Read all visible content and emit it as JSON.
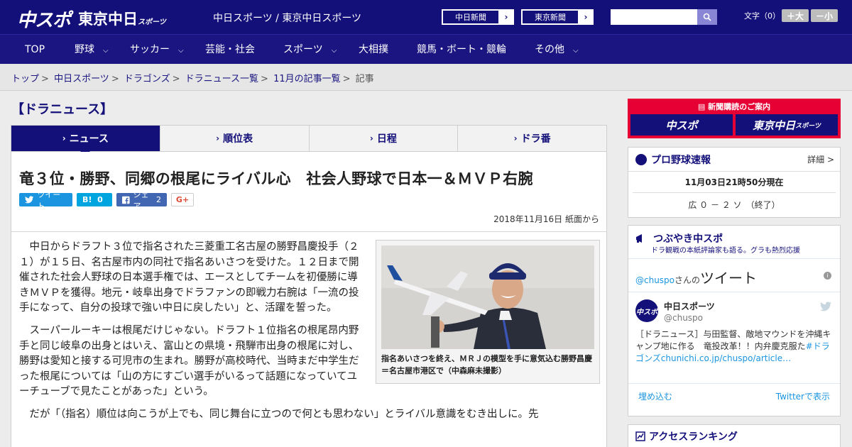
{
  "header": {
    "logo_chuspo": "中スポ",
    "logo_tokyo": "東京中日",
    "logo_tokyo_sub": "スポーツ",
    "site_title": "中日スポーツ / 東京中日スポーツ",
    "ext_links": [
      {
        "label": "中日新聞",
        "arrow": "›"
      },
      {
        "label": "東京新聞",
        "arrow": "›"
      }
    ],
    "search_placeholder": "",
    "font_size_label": "文字（0）",
    "font_larger": "＋大",
    "font_smaller": "－小"
  },
  "nav": {
    "items": [
      {
        "label": "TOP",
        "chevron": ""
      },
      {
        "label": "野球",
        "chevron": "⌵"
      },
      {
        "label": "サッカー",
        "chevron": "⌵"
      },
      {
        "label": "芸能・社会",
        "chevron": ""
      },
      {
        "label": "スポーツ",
        "chevron": "⌵"
      },
      {
        "label": "大相撲",
        "chevron": ""
      },
      {
        "label": "競馬・ボート・競輪",
        "chevron": ""
      },
      {
        "label": "その他",
        "chevron": "⌵"
      }
    ]
  },
  "breadcrumb": {
    "items": [
      "トップ",
      "中日スポーツ",
      "ドラゴンズ",
      "ドラニュース一覧",
      "11月の記事一覧"
    ],
    "current": "記事",
    "sep": ">"
  },
  "section": {
    "heading": "【ドラニュース】"
  },
  "tabs": [
    {
      "label": "ニュース",
      "active": true
    },
    {
      "label": "順位表",
      "active": false
    },
    {
      "label": "日程",
      "active": false
    },
    {
      "label": "ドラ番",
      "active": false
    }
  ],
  "article": {
    "title": "竜３位・勝野、同郷の根尾にライバル心　社会人野球で日本一＆ＭＶＰ右腕",
    "share": {
      "tweet": "ツイート",
      "hatena_icon": "B!",
      "hatena_count": "0",
      "facebook": "シェア",
      "facebook_count": "2",
      "gplus": "G+"
    },
    "date": "2018年11月16日 紙面から",
    "photo_caption": "指名あいさつを終え、ＭＲＪの模型を手に意気込む勝野昌慶＝名古屋市港区で（中森麻未撮影）",
    "paragraphs": [
      "中日からドラフト３位で指名された三菱重工名古屋の勝野昌慶投手（２１）が１５日、名古屋市内の同社で指名あいさつを受けた。１２日まで開催された社会人野球の日本選手権では、エースとしてチームを初優勝に導きＭＶＰを獲得。地元・岐阜出身でドラファンの即戦力右腕は「一流の投手になって、自分の投球で強い中日に戻したい」と、活躍を誓った。",
      "スーパールーキーは根尾だけじゃない。ドラフト１位指名の根尾昂内野手と同じ岐阜の出身とはいえ、富山との県境・飛騨市出身の根尾に対し、勝野は愛知と接する可児市の生まれ。勝野が高校時代、当時まだ中学生だった根尾については「山の方にすごい選手がいるって話題になっていてユーチューブで見たことがあった」という。",
      "だが「（指名）順位は向こうが上でも、同じ舞台に立つので何とも思わない」とライバル意識をむき出しに。先"
    ]
  },
  "sidebar": {
    "subscribe": {
      "title": "新聞購読のご案内",
      "btn_chuspo": "中スポ",
      "btn_tokyo": "東京中日",
      "btn_tokyo_sub": "スポーツ"
    },
    "baseball": {
      "title": "プロ野球速報",
      "more": "詳細 >",
      "time": "11月03日21時50分現在",
      "score": "広 ０ － ２ ソ　（終了）"
    },
    "tweets": {
      "title": "つぶやき中スポ",
      "subtitle": "ドラ観戦の本紙評論家も語る。グラも熱烈応援",
      "user_handle_prefix": "@chuspo",
      "user_suffix": "さんの",
      "tweet_word": "ツイート",
      "tweet_name": "中日スポーツ",
      "tweet_handle": "@chuspo",
      "avatar_text": "中スポ",
      "tweet_text_1": "［ドラニュース］与田監督、敵地マウンドを沖縄キャンプ地に作る　竜投改革！！内弁慶克服た",
      "tweet_link": "#ドラゴンズ",
      "tweet_url": "chunichi.co.jp/chuspo/article…",
      "embed_label": "埋め込む",
      "view_on_twitter": "Twitterで表示"
    },
    "ranking": {
      "title": "アクセスランキング"
    }
  },
  "colors": {
    "brand_navy": "#14107a",
    "nav_bg": "#1a1580",
    "subscribe_red": "#e60033",
    "twitter_blue": "#1b95e0"
  }
}
